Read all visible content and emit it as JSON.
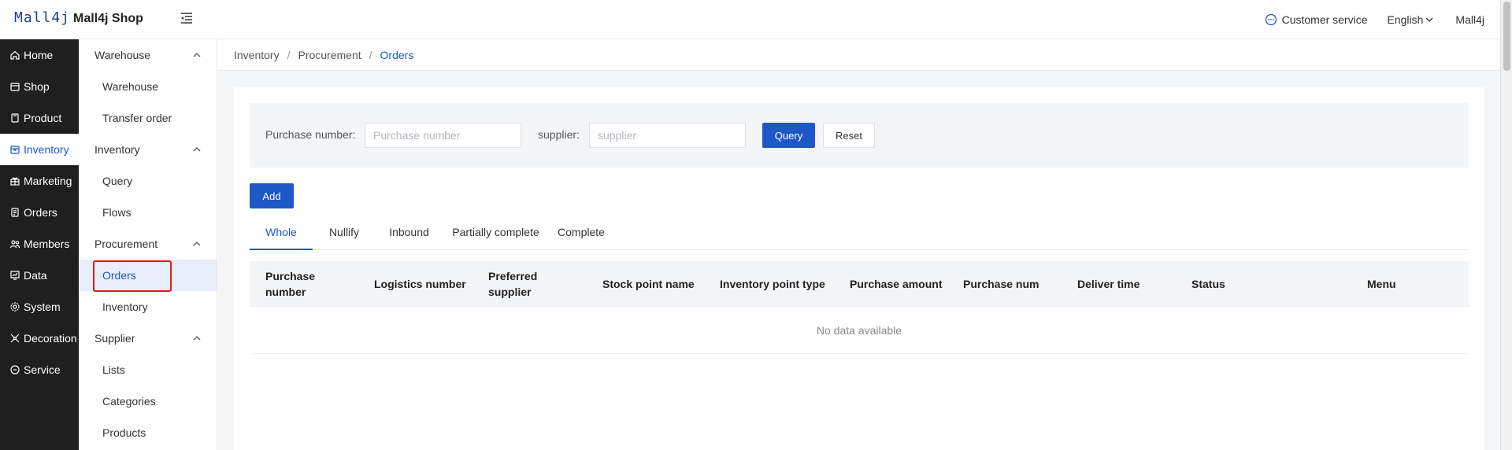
{
  "header": {
    "logo": "Mall4j",
    "shop_name": "Mall4j Shop",
    "customer_service": "Customer service",
    "language": "English",
    "user": "Mall4j"
  },
  "nav": {
    "items": [
      {
        "label": "Home",
        "icon": "home-icon"
      },
      {
        "label": "Shop",
        "icon": "shop-icon"
      },
      {
        "label": "Product",
        "icon": "product-icon"
      },
      {
        "label": "Inventory",
        "icon": "inventory-icon",
        "active": true
      },
      {
        "label": "Marketing",
        "icon": "gift-icon"
      },
      {
        "label": "Orders",
        "icon": "orders-icon"
      },
      {
        "label": "Members",
        "icon": "members-icon"
      },
      {
        "label": "Data",
        "icon": "chart-icon"
      },
      {
        "label": "System",
        "icon": "gear-icon"
      },
      {
        "label": "Decoration",
        "icon": "palette-icon"
      },
      {
        "label": "Service",
        "icon": "chat-icon"
      }
    ]
  },
  "subnav": {
    "groups": [
      {
        "label": "Warehouse",
        "items": [
          "Warehouse",
          "Transfer order"
        ]
      },
      {
        "label": "Inventory",
        "items": [
          "Query",
          "Flows"
        ]
      },
      {
        "label": "Procurement",
        "items": [
          "Orders",
          "Inventory"
        ]
      },
      {
        "label": "Supplier",
        "items": [
          "Lists",
          "Categories",
          "Products"
        ]
      }
    ],
    "active_item": "Orders"
  },
  "breadcrumb": [
    "Inventory",
    "Procurement",
    "Orders"
  ],
  "search": {
    "purchase_label": "Purchase number:",
    "purchase_placeholder": "Purchase number",
    "purchase_value": "",
    "supplier_label": "supplier:",
    "supplier_placeholder": "supplier",
    "supplier_value": "",
    "query_label": "Query",
    "reset_label": "Reset"
  },
  "add_label": "Add",
  "tabs": [
    "Whole",
    "Nullify",
    "Inbound",
    "Partially complete",
    "Complete"
  ],
  "active_tab": "Whole",
  "table": {
    "columns": [
      "Purchase number",
      "Logistics number",
      "Preferred supplier",
      "Stock point name",
      "Inventory point type",
      "Purchase amount",
      "Purchase num",
      "Deliver time",
      "Status",
      "Menu"
    ],
    "empty_text": "No data available"
  },
  "colors": {
    "accent": "#1e58c8",
    "sidebar_dark": "#1f1f1f",
    "highlight_box": "#e01a1a"
  }
}
